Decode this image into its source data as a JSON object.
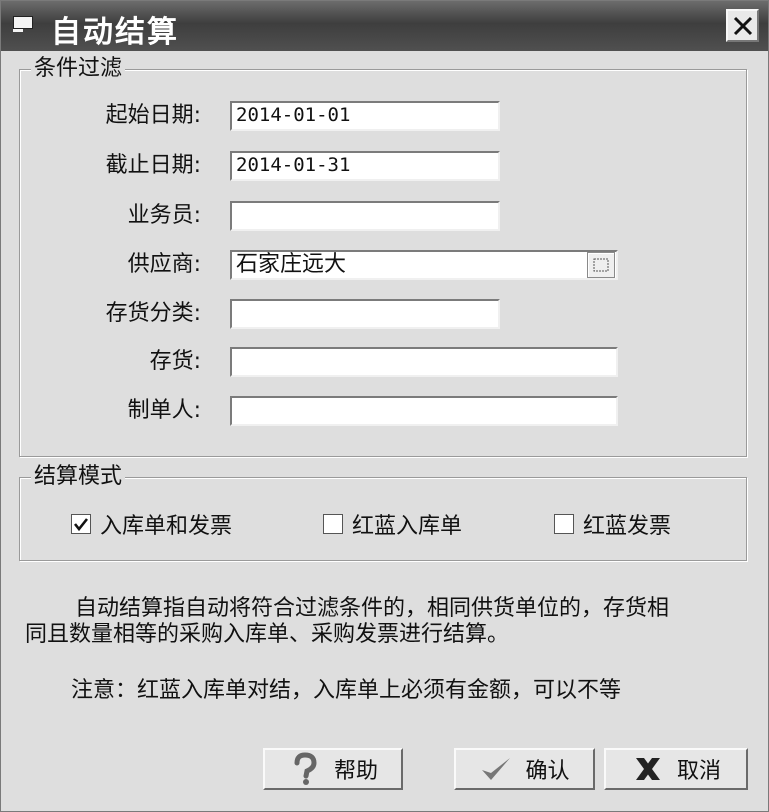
{
  "window": {
    "title": "自动结算"
  },
  "filter": {
    "legend": "条件过滤",
    "fields": {
      "start_date": {
        "label": "起始日期:",
        "value": "2014-01-01"
      },
      "end_date": {
        "label": "截止日期:",
        "value": "2014-01-31"
      },
      "salesperson": {
        "label": "业务员:",
        "value": ""
      },
      "supplier": {
        "label": "供应商:",
        "value": "石家庄远大"
      },
      "inventory_category": {
        "label": "存货分类:",
        "value": ""
      },
      "inventory": {
        "label": "存货:",
        "value": ""
      },
      "preparer": {
        "label": "制单人:",
        "value": ""
      }
    }
  },
  "mode": {
    "legend": "结算模式",
    "options": [
      {
        "label": "入库单和发票",
        "checked": true
      },
      {
        "label": "红蓝入库单",
        "checked": false
      },
      {
        "label": "红蓝发票",
        "checked": false
      }
    ]
  },
  "description": {
    "line1": "自动结算指自动将符合过滤条件的，相同供货单位的，存货相",
    "line2": "同且数量相等的采购入库单、采购发票进行结算。",
    "note": "注意：红蓝入库单对结，入库单上必须有金额，可以不等"
  },
  "buttons": {
    "help": {
      "label": "帮助",
      "icon": "question-icon"
    },
    "ok": {
      "label": "确认",
      "icon": "checkmark-icon"
    },
    "cancel": {
      "label": "取消",
      "icon": "x-icon"
    }
  }
}
